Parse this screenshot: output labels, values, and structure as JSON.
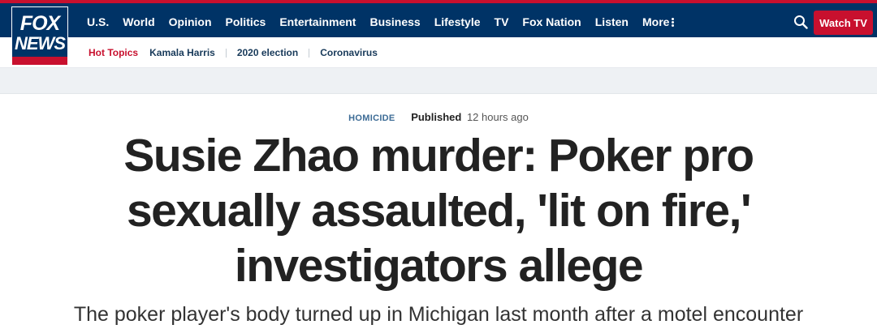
{
  "brand": {
    "logo_top": "FOX",
    "logo_bottom": "NEWS"
  },
  "nav": {
    "items": [
      "U.S.",
      "World",
      "Opinion",
      "Politics",
      "Entertainment",
      "Business",
      "Lifestyle",
      "TV",
      "Fox Nation",
      "Listen"
    ],
    "more_label": "More",
    "watch_tv_label": "Watch TV"
  },
  "subnav": {
    "hot_topics_label": "Hot Topics",
    "topics": [
      "Kamala Harris",
      "2020 election",
      "Coronavirus"
    ]
  },
  "article": {
    "category": "HOMICIDE",
    "published_label": "Published",
    "published_time": "12 hours ago",
    "headline": "Susie Zhao murder: Poker pro sexually assaulted, 'lit on fire,' investigators allege",
    "dek": "The poker player's body turned up in Michigan last month after a motel encounter"
  },
  "colors": {
    "nav_bg": "#003366",
    "accent_red": "#c8102e"
  },
  "icons": {
    "search": "search-icon",
    "more": "more-dots-icon"
  }
}
